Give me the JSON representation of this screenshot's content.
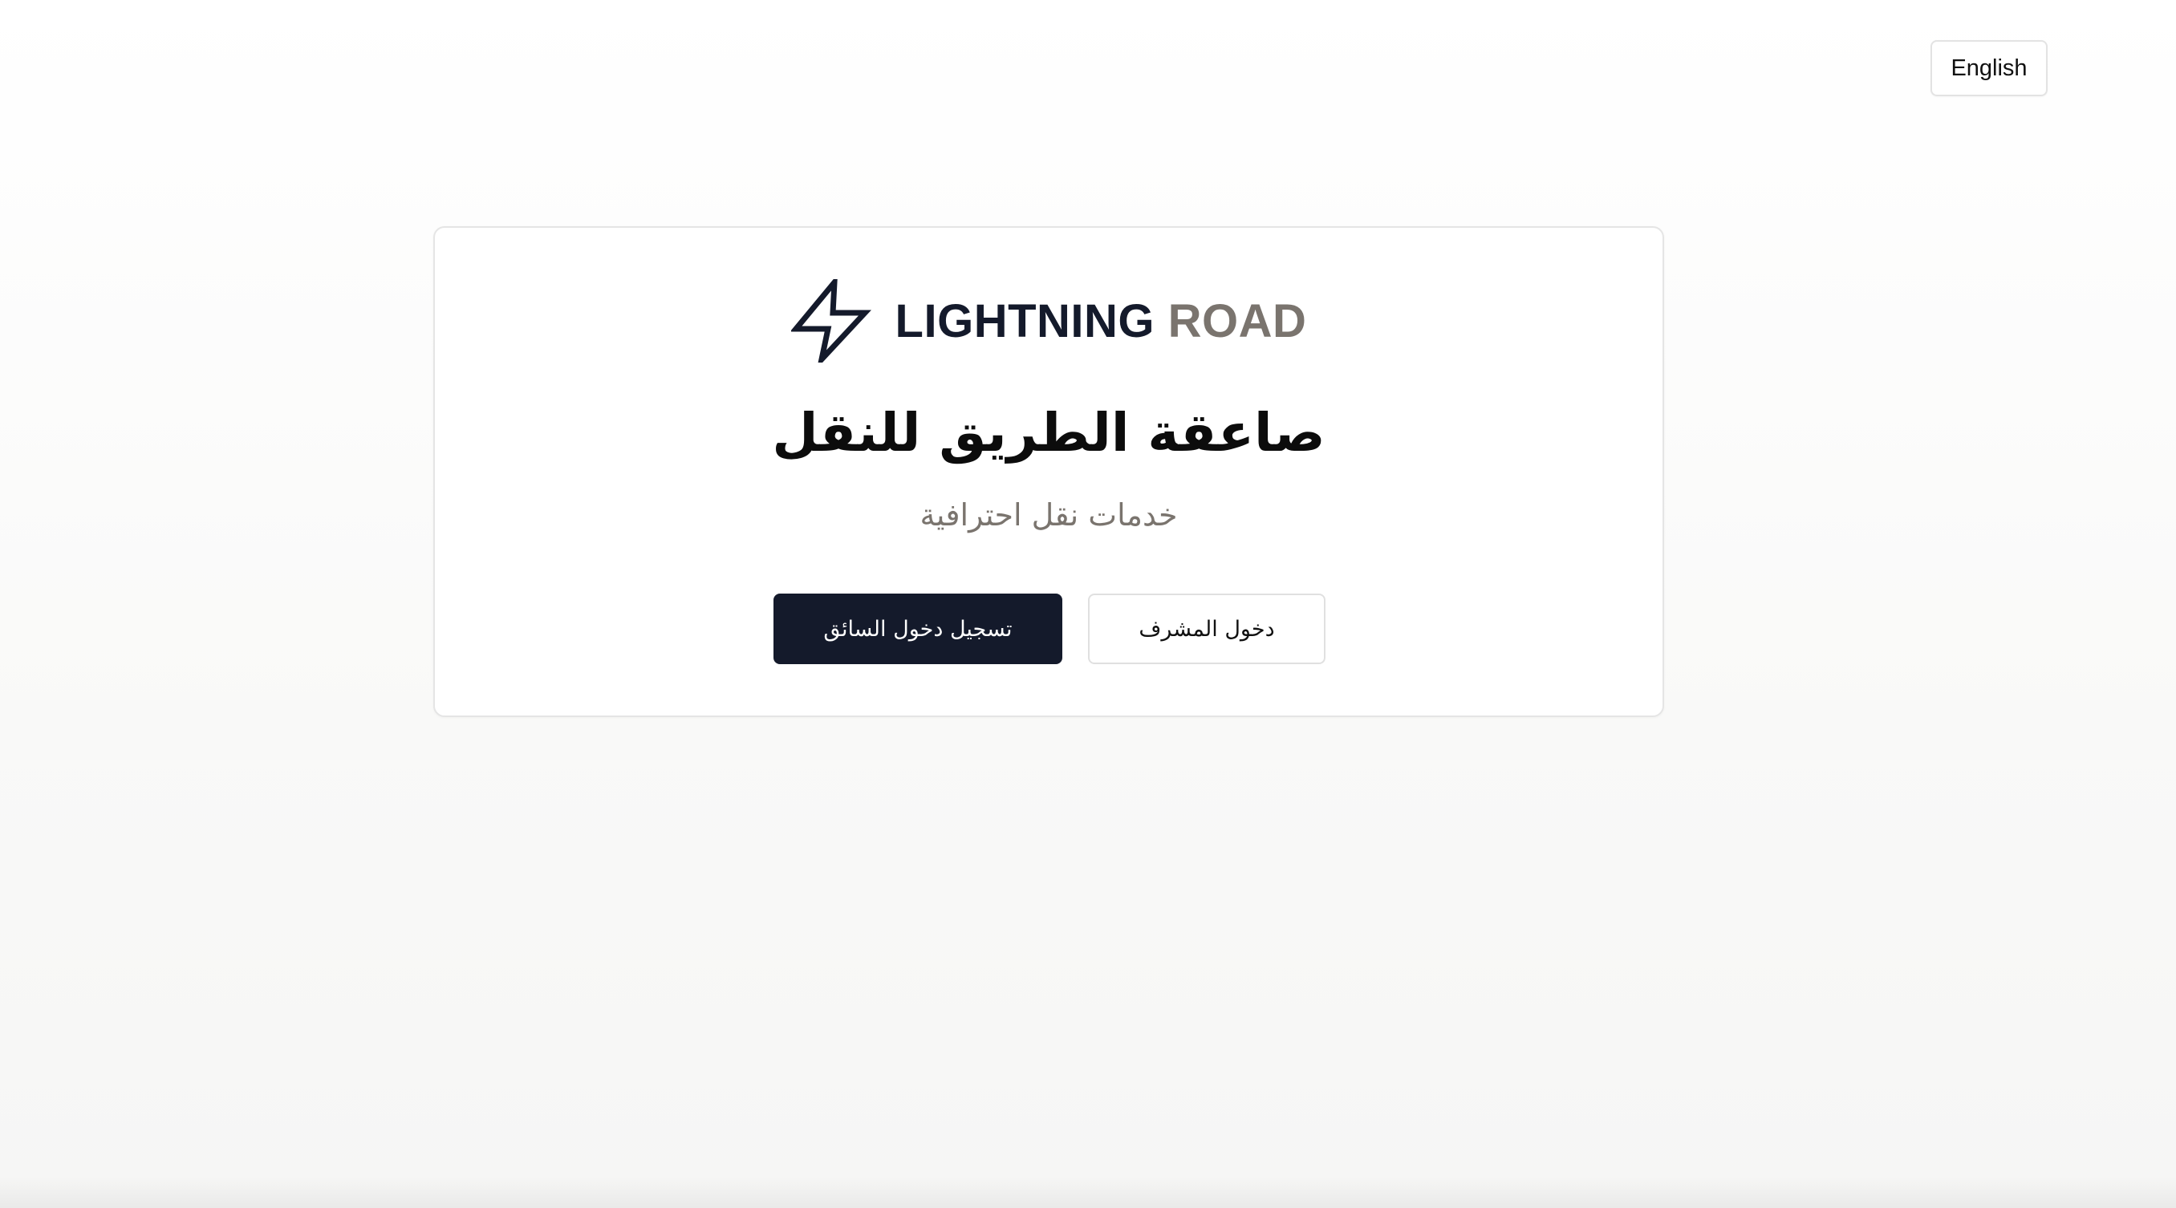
{
  "header": {
    "language_button": "English"
  },
  "card": {
    "logo": {
      "icon": "lightning-bolt-icon",
      "brand_part1": "LIGHTNING",
      "brand_part2": "ROAD"
    },
    "title": "صاعقة الطريق للنقل",
    "subtitle": "خدمات نقل احترافية",
    "buttons": {
      "driver_login": "تسجيل دخول السائق",
      "admin_login": "دخول المشرف"
    }
  },
  "colors": {
    "primary_dark": "#141a2b",
    "brand_gray": "#7a746e"
  }
}
